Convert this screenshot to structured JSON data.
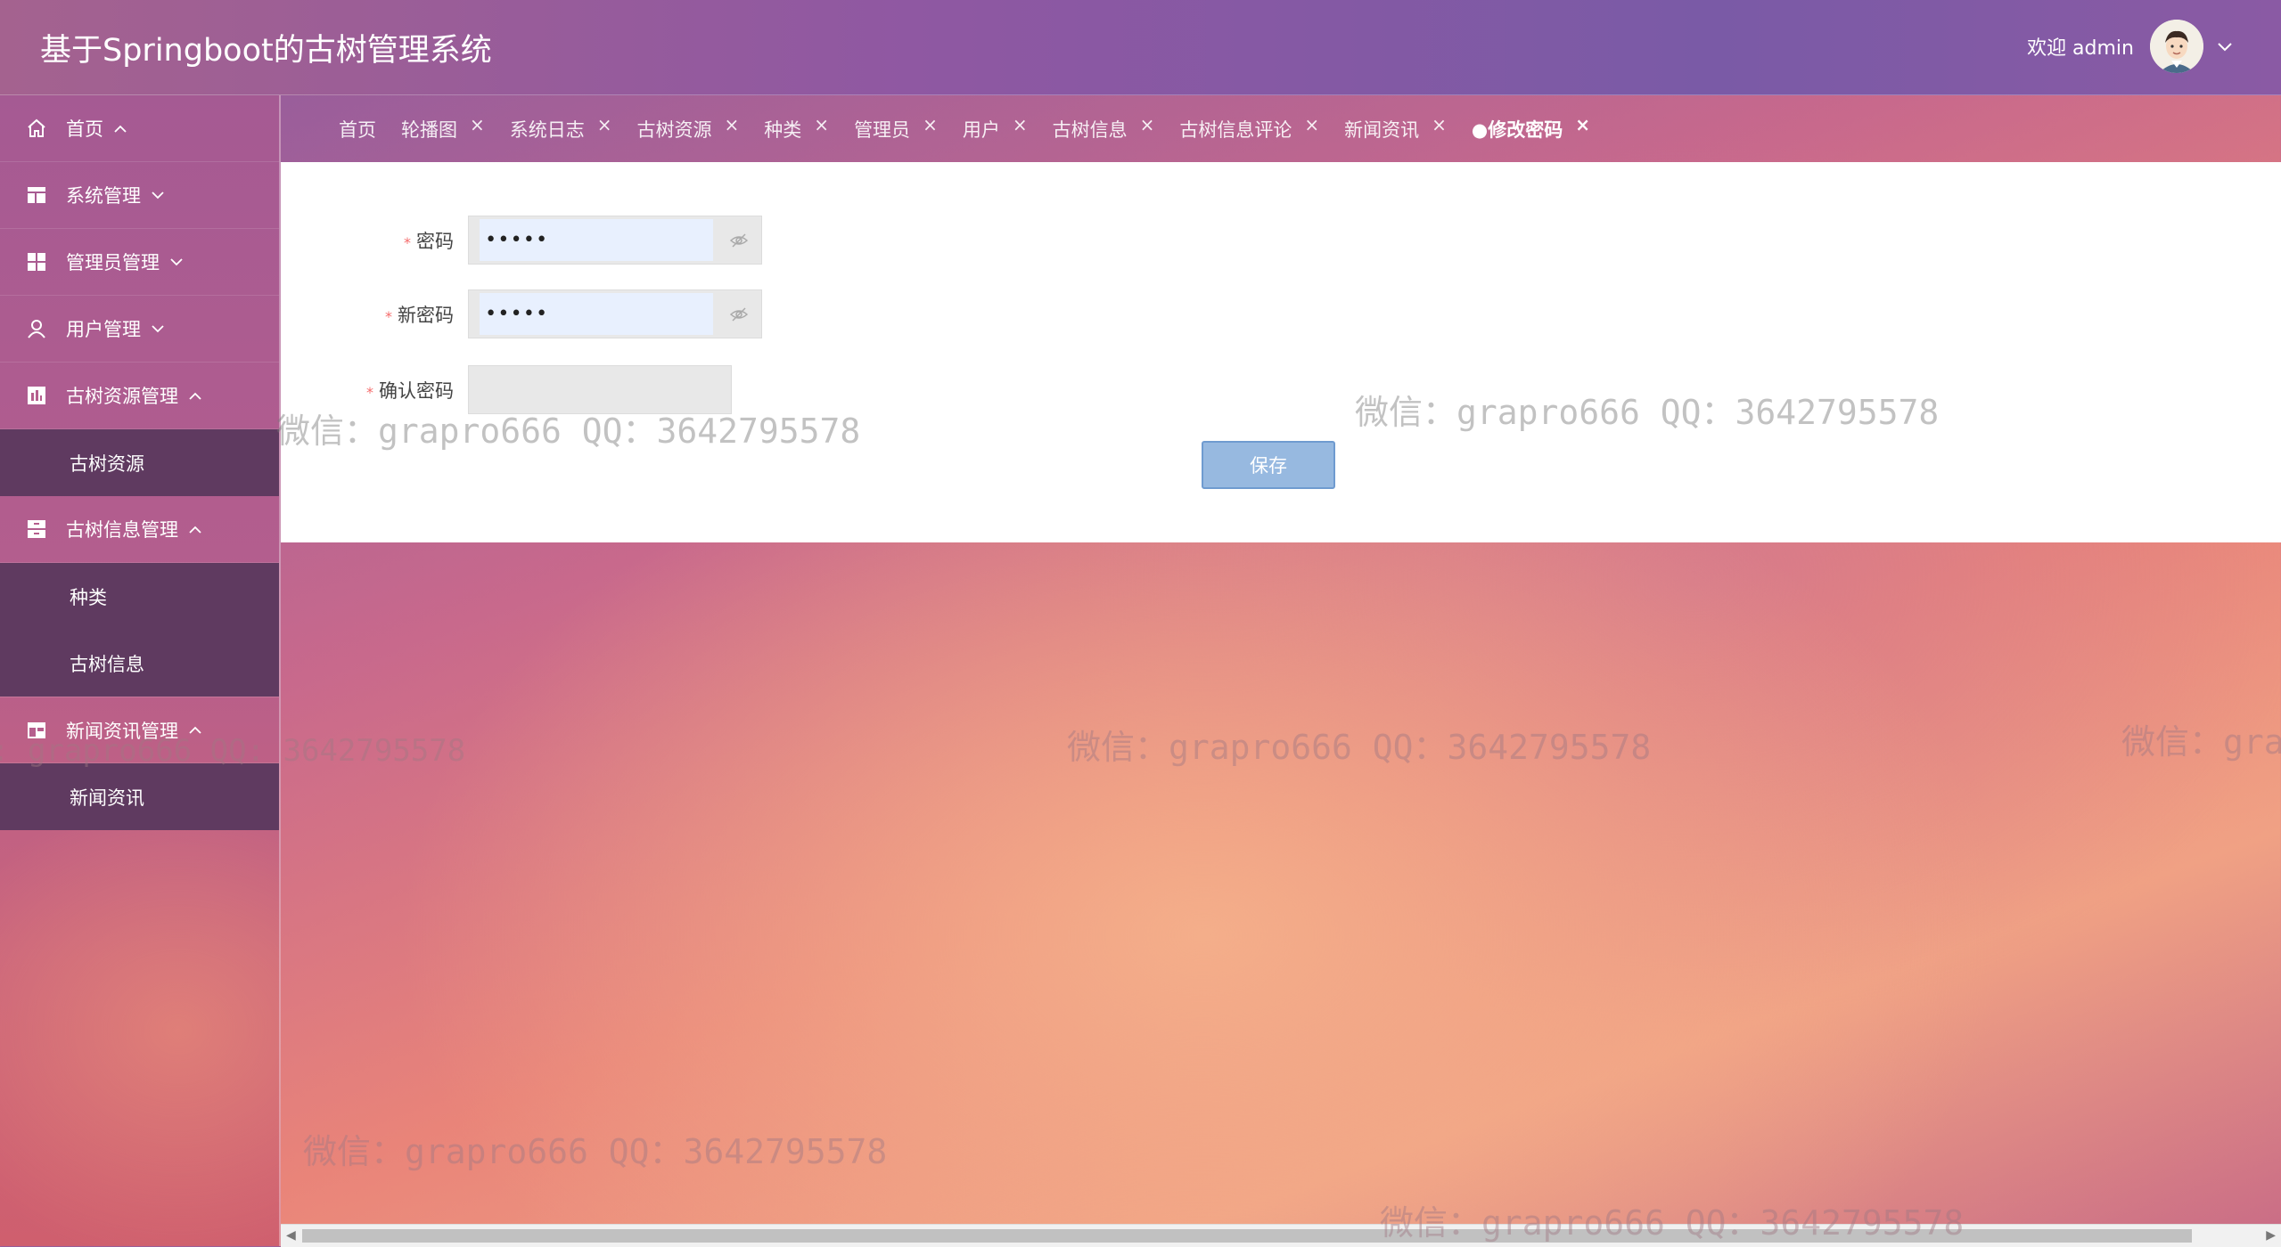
{
  "header": {
    "title": "基于Springboot的古树管理系统",
    "welcome": "欢迎 admin"
  },
  "sidebar": {
    "items": [
      {
        "label": "首页"
      },
      {
        "label": "系统管理"
      },
      {
        "label": "管理员管理"
      },
      {
        "label": "用户管理"
      },
      {
        "label": "古树资源管理",
        "children": [
          "古树资源"
        ]
      },
      {
        "label": "古树信息管理",
        "children": [
          "种类",
          "古树信息"
        ]
      },
      {
        "label": "新闻资讯管理",
        "children": [
          "新闻资讯"
        ]
      }
    ]
  },
  "tabs": [
    {
      "label": "首页",
      "closable": false
    },
    {
      "label": "轮播图",
      "closable": true
    },
    {
      "label": "系统日志",
      "closable": true
    },
    {
      "label": "古树资源",
      "closable": true
    },
    {
      "label": "种类",
      "closable": true
    },
    {
      "label": "管理员",
      "closable": true
    },
    {
      "label": "用户",
      "closable": true
    },
    {
      "label": "古树信息",
      "closable": true
    },
    {
      "label": "古树信息评论",
      "closable": true
    },
    {
      "label": "新闻资讯",
      "closable": true
    },
    {
      "label": "●修改密码",
      "closable": true,
      "active": true
    }
  ],
  "form": {
    "password_label": "密码",
    "password_value": "•••••",
    "new_password_label": "新密码",
    "new_password_value": "•••••",
    "confirm_label": "确认密码",
    "confirm_value": "",
    "required_mark": "*",
    "save_label": "保存"
  },
  "watermark": "微信：grapro666 QQ：3642795578",
  "watermark_partial_left": ": grapro666 QQ: 3642795578",
  "watermark_partial_right": "微信：gra",
  "colors": {
    "header": "#8f58a2",
    "sidebar_submenu": "#5f3a60",
    "save_button": "#97b9e0",
    "required": "#f56c6c"
  }
}
